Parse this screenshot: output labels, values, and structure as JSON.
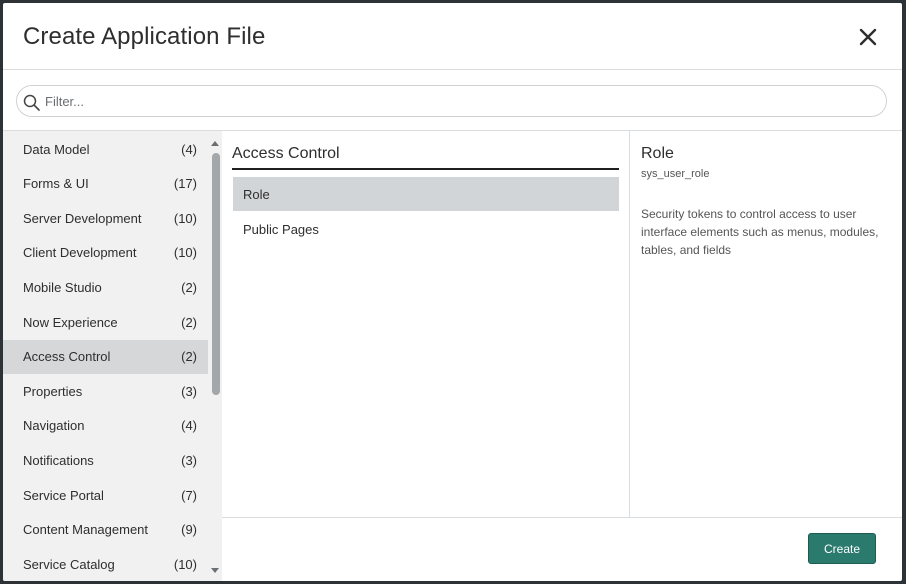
{
  "modal": {
    "title": "Create Application File",
    "close_label": "Close"
  },
  "filter": {
    "placeholder": "Filter...",
    "value": ""
  },
  "categories": [
    {
      "label": "Data Model",
      "count": "(4)"
    },
    {
      "label": "Forms & UI",
      "count": "(17)"
    },
    {
      "label": "Server Development",
      "count": "(10)"
    },
    {
      "label": "Client Development",
      "count": "(10)"
    },
    {
      "label": "Mobile Studio",
      "count": "(2)"
    },
    {
      "label": "Now Experience",
      "count": "(2)"
    },
    {
      "label": "Access Control",
      "count": "(2)"
    },
    {
      "label": "Properties",
      "count": "(3)"
    },
    {
      "label": "Navigation",
      "count": "(4)"
    },
    {
      "label": "Notifications",
      "count": "(3)"
    },
    {
      "label": "Service Portal",
      "count": "(7)"
    },
    {
      "label": "Content Management",
      "count": "(9)"
    },
    {
      "label": "Service Catalog",
      "count": "(10)"
    }
  ],
  "selected_category_index": 6,
  "types": {
    "heading": "Access Control",
    "items": [
      {
        "label": "Role"
      },
      {
        "label": "Public Pages"
      }
    ],
    "selected_index": 0
  },
  "description": {
    "title": "Role",
    "table": "sys_user_role",
    "text": "Security tokens to control access to user interface elements such as menus, modules, tables, and fields"
  },
  "footer": {
    "create_label": "Create"
  },
  "colors": {
    "primary_button": "#2b7a6e",
    "selected_row": "#d5d7d9",
    "category_bg": "#f1f1f1"
  },
  "icons": {
    "close": "close-icon",
    "filter": "search-icon",
    "scroll_up": "chevron-up-icon",
    "scroll_down": "chevron-down-icon"
  }
}
